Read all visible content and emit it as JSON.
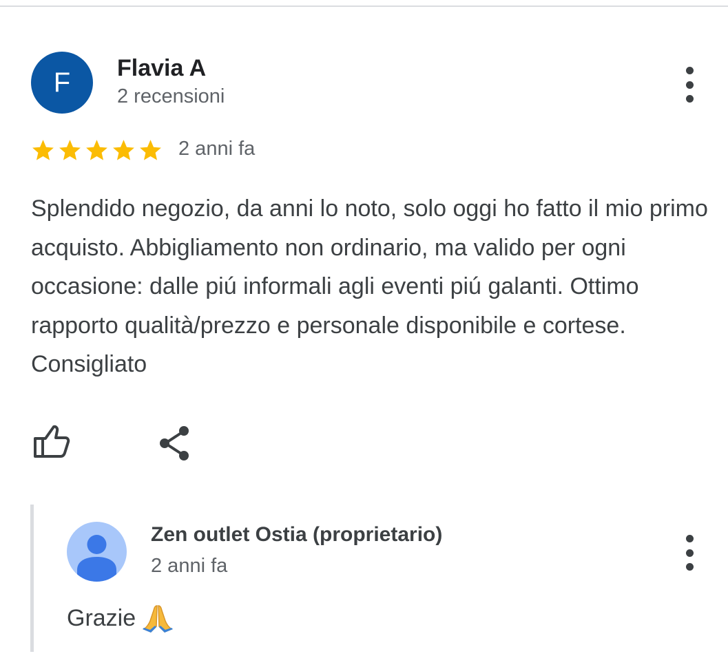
{
  "review": {
    "avatar_letter": "F",
    "reviewer_name": "Flavia A",
    "reviewer_meta": "2 recensioni",
    "rating": 5,
    "max_rating": 5,
    "date": "2 anni fa",
    "text": "Splendido negozio, da anni lo noto, solo oggi ho fatto il mio primo acquisto. Abbigliamento non ordinario, ma valido per ogni occasione: dalle piú informali agli eventi piú galanti. Ottimo rapporto qualità/prezzo e personale disponibile e cortese. Consigliato"
  },
  "owner_reply": {
    "name": "Zen outlet Ostia (proprietario)",
    "date": "2 anni fa",
    "text": "Grazie",
    "emoji_icon": "folded-hands-icon"
  },
  "icons": {
    "more": "more-vert-icon",
    "like": "thumb-up-icon",
    "share": "share-icon",
    "star": "star-icon",
    "owner_avatar": "person-icon"
  },
  "colors": {
    "avatar_bg": "#0b57a4",
    "star": "#fbbc04",
    "owner_avatar_bg": "#a8c7fa",
    "owner_avatar_fg": "#3b78e7",
    "text_primary": "#202124",
    "text_secondary": "#5f6368"
  }
}
